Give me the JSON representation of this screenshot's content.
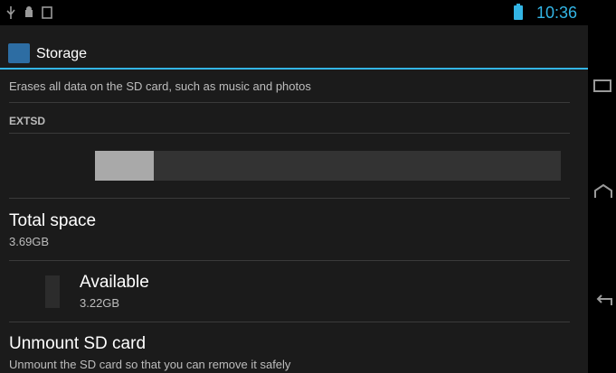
{
  "status_bar": {
    "time": "10:36"
  },
  "action_bar": {
    "title": "Storage"
  },
  "content": {
    "erase_summary": "Erases all data on the SD card, such as music and photos",
    "section_header": "EXTSD",
    "storage_used_fraction": 0.127,
    "total_space": {
      "title": "Total space",
      "value": "3.69GB"
    },
    "available": {
      "title": "Available",
      "value": "3.22GB"
    },
    "unmount": {
      "title": "Unmount SD card",
      "summary": "Unmount the SD card so that you can remove it safely"
    }
  },
  "colors": {
    "accent": "#33b5e5",
    "used": "#a9a9a9",
    "bar_bg": "#333333"
  },
  "icons": [
    "usb-icon",
    "android-debug-icon",
    "sd-card-icon",
    "battery-icon",
    "storage-app-icon",
    "recent-apps-icon",
    "home-icon",
    "back-icon"
  ]
}
